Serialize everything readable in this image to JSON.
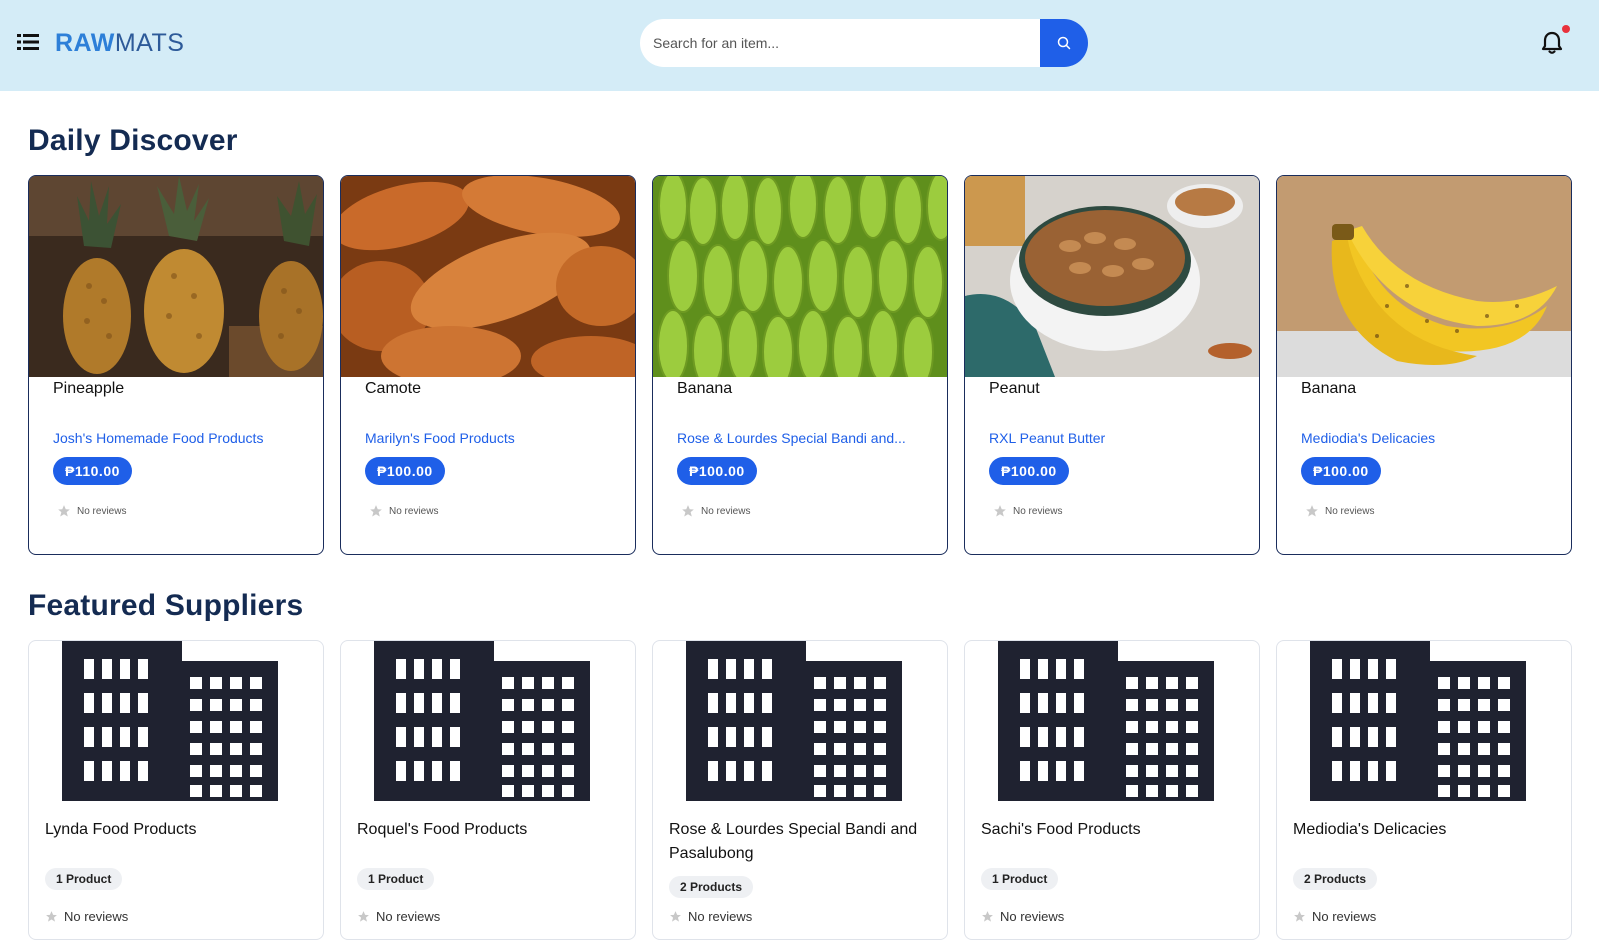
{
  "header": {
    "logo_raw": "RAW",
    "logo_mats": "MATS",
    "search_placeholder": "Search for an item..."
  },
  "daily": {
    "title": "Daily Discover",
    "items": [
      {
        "name": "Pineapple",
        "supplier": "Josh's Homemade Food Products",
        "price": "₱110.00",
        "reviews": "No reviews",
        "image": "pineapple"
      },
      {
        "name": "Camote",
        "supplier": "Marilyn's Food Products",
        "price": "₱100.00",
        "reviews": "No reviews",
        "image": "sweet-potato"
      },
      {
        "name": "Banana",
        "supplier": "Rose & Lourdes Special Bandi and...",
        "price": "₱100.00",
        "reviews": "No reviews",
        "image": "green-bananas"
      },
      {
        "name": "Peanut",
        "supplier": "RXL Peanut Butter",
        "price": "₱100.00",
        "reviews": "No reviews",
        "image": "peanuts"
      },
      {
        "name": "Banana",
        "supplier": "Mediodia's Delicacies",
        "price": "₱100.00",
        "reviews": "No reviews",
        "image": "ripe-bananas"
      }
    ]
  },
  "featured": {
    "title": "Featured Suppliers",
    "items": [
      {
        "name": "Lynda Food Products",
        "count": "1 Product",
        "reviews": "No reviews"
      },
      {
        "name": "Roquel's Food Products",
        "count": "1 Product",
        "reviews": "No reviews"
      },
      {
        "name": "Rose & Lourdes Special Bandi and Pasalubong",
        "count": "2 Products",
        "reviews": "No reviews"
      },
      {
        "name": "Sachi's Food Products",
        "count": "1 Product",
        "reviews": "No reviews"
      },
      {
        "name": "Mediodia's Delicacies",
        "count": "2 Products",
        "reviews": "No reviews"
      }
    ]
  },
  "colors": {
    "header_bg": "#d4ecf7",
    "accent": "#1f5fe8",
    "heading": "#142b52",
    "card_border": "#1a2d5c",
    "notification_dot": "#e8323c"
  },
  "icons": [
    "menu-grid-icon",
    "search-icon",
    "bell-icon",
    "star-icon",
    "building-icon"
  ]
}
